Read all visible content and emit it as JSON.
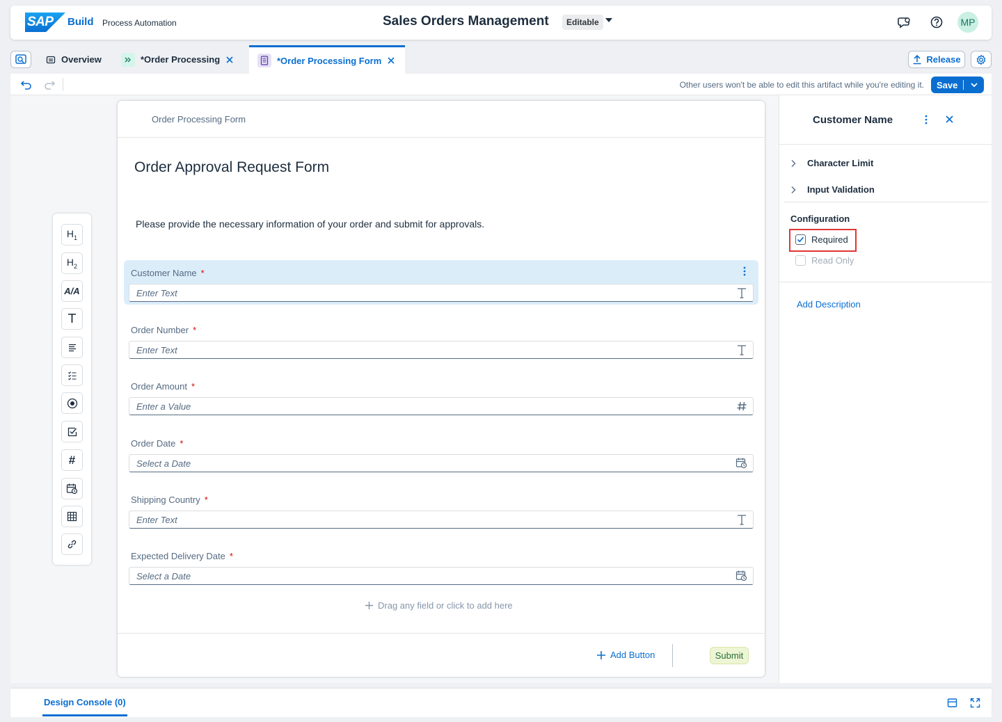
{
  "shell": {
    "logo_text": "SAP",
    "product": "Build",
    "subproduct": "Process Automation",
    "title": "Sales Orders Management",
    "status_badge": "Editable",
    "avatar_initials": "MP"
  },
  "tabs": [
    {
      "label": "Overview",
      "icon": "overview-icon",
      "active": false
    },
    {
      "label": "*Order Processing",
      "icon": "process-icon",
      "active": false
    },
    {
      "label": "*Order Processing Form",
      "icon": "form-icon",
      "active": true
    }
  ],
  "actions": {
    "release": "Release",
    "save": "Save"
  },
  "toolbar": {
    "message": "Other users won't be able to edit this artifact while you're editing it."
  },
  "palette": {
    "items": [
      "H1",
      "H2",
      "text-style",
      "text",
      "paragraph",
      "checklist",
      "radio",
      "checkbox",
      "number",
      "date",
      "table",
      "link"
    ]
  },
  "form": {
    "header": "Order Processing Form",
    "title": "Order Approval Request Form",
    "description": "Please provide the necessary information of your order and submit for approvals.",
    "fields": [
      {
        "label": "Customer Name",
        "required": "*",
        "placeholder": "Enter Text",
        "icon": "text-icon",
        "selected": true
      },
      {
        "label": "Order Number",
        "required": "*",
        "placeholder": "Enter Text",
        "icon": "text-icon"
      },
      {
        "label": "Order Amount",
        "required": "*",
        "placeholder": "Enter a Value",
        "icon": "number-icon"
      },
      {
        "label": "Order Date",
        "required": "*",
        "placeholder": "Select a Date",
        "icon": "calendar-icon"
      },
      {
        "label": "Shipping Country",
        "required": "*",
        "placeholder": "Enter Text",
        "icon": "text-icon"
      },
      {
        "label": "Expected Delivery Date",
        "required": "*",
        "placeholder": "Select a Date",
        "icon": "calendar-icon"
      }
    ],
    "drop_hint": "Drag any field or click to add here",
    "add_button": "Add Button",
    "submit": "Submit"
  },
  "properties": {
    "title": "Customer Name",
    "sections": [
      "Character Limit",
      "Input Validation"
    ],
    "configuration_label": "Configuration",
    "required_label": "Required",
    "required_checked": true,
    "readonly_label": "Read Only",
    "readonly_checked": false,
    "add_description": "Add Description"
  },
  "console": {
    "tab": "Design Console (0)"
  },
  "colors": {
    "accent": "#0a6ed1",
    "selected_field": "#dcedfa",
    "required_star": "#d20a0a",
    "highlight": "#e23434"
  }
}
